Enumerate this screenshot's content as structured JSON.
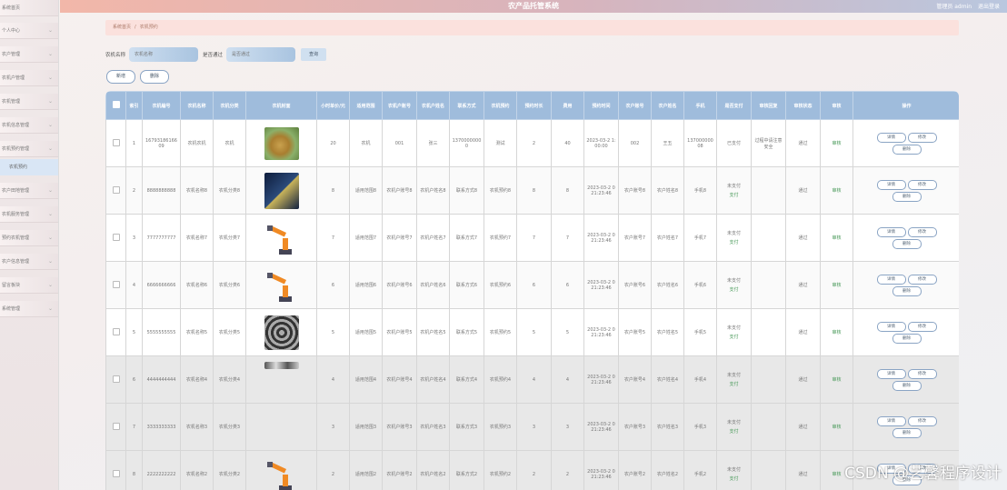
{
  "header": {
    "title": "农产品托管系统",
    "user_role": "管理员 admin",
    "logout": "退出登录"
  },
  "sidebar": {
    "items": [
      {
        "label": "系统首页"
      },
      {
        "label": "个人中心"
      },
      {
        "label": "农户管理"
      },
      {
        "label": "农机户管理"
      },
      {
        "label": "农机管理"
      },
      {
        "label": "农机信息管理"
      },
      {
        "label": "农机预约管理"
      },
      {
        "label": "农户田地管理"
      },
      {
        "label": "农机服务管理"
      },
      {
        "label": "预约农机管理"
      },
      {
        "label": "农户信息管理"
      },
      {
        "label": "留言板块"
      },
      {
        "label": "系统管理"
      }
    ],
    "sub_item": "农机预约"
  },
  "breadcrumb": {
    "home": "系统首页",
    "sep": "/",
    "current": "农机预约"
  },
  "search": {
    "label1": "农机名称",
    "placeholder1": "农机名称",
    "label2": "是否通过",
    "placeholder2": "是否通过",
    "button": "查询"
  },
  "actions": {
    "add": "新增",
    "delete": "删除"
  },
  "table": {
    "headers": [
      "",
      "索引",
      "农机编号",
      "农机名称",
      "农机分类",
      "农机封面",
      "小时单价/元",
      "适用范围",
      "农机户账号",
      "农机户姓名",
      "联系方式",
      "农机预约",
      "预约时长",
      "费用",
      "预约时间",
      "农户账号",
      "农户姓名",
      "手机",
      "是否支付",
      "审核回复",
      "审核状态",
      "审核",
      "操作"
    ],
    "row_buttons": {
      "detail": "详情",
      "edit": "修改",
      "delete": "删除"
    },
    "rows": [
      {
        "idx": "1",
        "code": "1679318616609",
        "name": "农机农机",
        "cat": "农机",
        "price": "20",
        "scope": "农机",
        "acct": "001",
        "owner": "张三",
        "phone": "13700000000",
        "resv": "测试",
        "hours": "2",
        "fee": "40",
        "time": "2023-03-2 1:00:00",
        "f_acct": "002",
        "f_name": "王五",
        "mobile": "13700000008",
        "paid": "已支付",
        "reply": "过程中请注意安全",
        "status": "通过",
        "audit": "审核",
        "pay_btn": ""
      },
      {
        "idx": "2",
        "code": "8888888888",
        "name": "农机名称8",
        "cat": "农机分类8",
        "price": "8",
        "scope": "适用范围8",
        "acct": "农机户账号8",
        "owner": "农机户姓名8",
        "phone": "联系方式8",
        "resv": "农机预约8",
        "hours": "8",
        "fee": "8",
        "time": "2023-03-2 0 21:23:46",
        "f_acct": "农户账号8",
        "f_name": "农户姓名8",
        "mobile": "手机8",
        "paid": "未支付",
        "reply": "",
        "status": "通过",
        "audit": "审核",
        "pay_btn": "支付"
      },
      {
        "idx": "3",
        "code": "7777777777",
        "name": "农机名称7",
        "cat": "农机分类7",
        "price": "7",
        "scope": "适用范围7",
        "acct": "农机户账号7",
        "owner": "农机户姓名7",
        "phone": "联系方式7",
        "resv": "农机预约7",
        "hours": "7",
        "fee": "7",
        "time": "2023-03-2 0 21:23:46",
        "f_acct": "农户账号7",
        "f_name": "农户姓名7",
        "mobile": "手机7",
        "paid": "未支付",
        "reply": "",
        "status": "通过",
        "audit": "审核",
        "pay_btn": "支付"
      },
      {
        "idx": "4",
        "code": "6666666666",
        "name": "农机名称6",
        "cat": "农机分类6",
        "price": "6",
        "scope": "适用范围6",
        "acct": "农机户账号6",
        "owner": "农机户姓名6",
        "phone": "联系方式6",
        "resv": "农机预约6",
        "hours": "6",
        "fee": "6",
        "time": "2023-03-2 0 21:23:46",
        "f_acct": "农户账号6",
        "f_name": "农户姓名6",
        "mobile": "手机6",
        "paid": "未支付",
        "reply": "",
        "status": "通过",
        "audit": "审核",
        "pay_btn": "支付"
      },
      {
        "idx": "5",
        "code": "5555555555",
        "name": "农机名称5",
        "cat": "农机分类5",
        "price": "5",
        "scope": "适用范围5",
        "acct": "农机户账号5",
        "owner": "农机户姓名5",
        "phone": "联系方式5",
        "resv": "农机预约5",
        "hours": "5",
        "fee": "5",
        "time": "2023-03-2 0 21:23:46",
        "f_acct": "农户账号5",
        "f_name": "农户姓名5",
        "mobile": "手机5",
        "paid": "未支付",
        "reply": "",
        "status": "通过",
        "audit": "审核",
        "pay_btn": "支付"
      },
      {
        "idx": "6",
        "code": "4444444444",
        "name": "农机名称4",
        "cat": "农机分类4",
        "price": "4",
        "scope": "适用范围4",
        "acct": "农机户账号4",
        "owner": "农机户姓名4",
        "phone": "联系方式4",
        "resv": "农机预约4",
        "hours": "4",
        "fee": "4",
        "time": "2023-03-2 0 21:23:46",
        "f_acct": "农户账号4",
        "f_name": "农户姓名4",
        "mobile": "手机4",
        "paid": "未支付",
        "reply": "",
        "status": "通过",
        "audit": "审核",
        "pay_btn": "支付"
      },
      {
        "idx": "7",
        "code": "3333333333",
        "name": "农机名称3",
        "cat": "农机分类3",
        "price": "3",
        "scope": "适用范围3",
        "acct": "农机户账号3",
        "owner": "农机户姓名3",
        "phone": "联系方式3",
        "resv": "农机预约3",
        "hours": "3",
        "fee": "3",
        "time": "2023-03-2 0 21:23:46",
        "f_acct": "农户账号3",
        "f_name": "农户姓名3",
        "mobile": "手机3",
        "paid": "未支付",
        "reply": "",
        "status": "通过",
        "audit": "审核",
        "pay_btn": "支付"
      },
      {
        "idx": "8",
        "code": "2222222222",
        "name": "农机名称2",
        "cat": "农机分类2",
        "price": "2",
        "scope": "适用范围2",
        "acct": "农机户账号2",
        "owner": "农机户姓名2",
        "phone": "联系方式2",
        "resv": "农机预约2",
        "hours": "2",
        "fee": "2",
        "time": "2023-03-2 0 21:23:46",
        "f_acct": "农户账号2",
        "f_name": "农户姓名2",
        "mobile": "手机2",
        "paid": "未支付",
        "reply": "",
        "status": "通过",
        "audit": "审核",
        "pay_btn": "支付"
      }
    ]
  },
  "watermark": "CSDN @艺馨程序设计",
  "colors": {
    "accent": "#9fbcdc",
    "header_pink": "#f2b7a9",
    "breadcrumb_bg": "#fbe1dd",
    "pass_green": "#4a9a5a"
  }
}
